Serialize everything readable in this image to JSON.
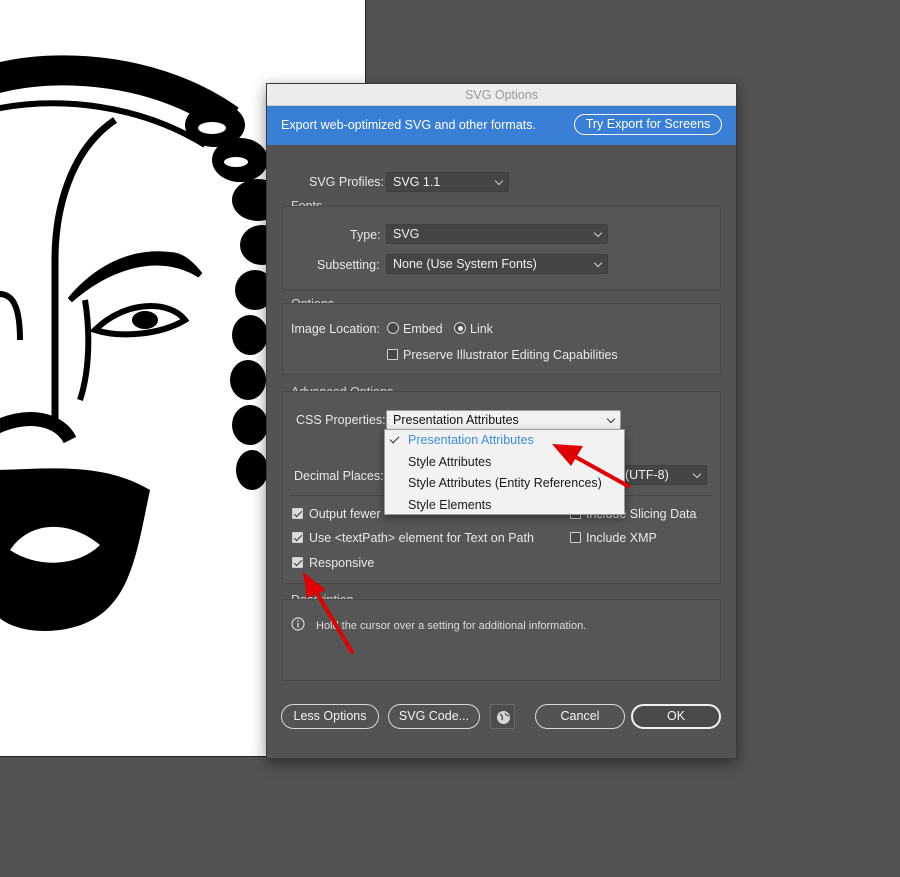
{
  "dialog": {
    "title": "SVG Options",
    "banner_text": "Export web-optimized SVG and other formats.",
    "banner_button": "Try Export for Screens",
    "svg_profiles": {
      "label": "SVG Profiles:",
      "value": "SVG 1.1"
    },
    "fonts": {
      "title": "Fonts",
      "type_label": "Type:",
      "type_value": "SVG",
      "subsetting_label": "Subsetting:",
      "subsetting_value": "None (Use System Fonts)"
    },
    "options": {
      "title": "Options",
      "image_location_label": "Image Location:",
      "embed_label": "Embed",
      "link_label": "Link",
      "selected_location": "Link",
      "preserve_label": "Preserve Illustrator Editing Capabilities",
      "preserve_checked": false
    },
    "advanced": {
      "title": "Advanced Options",
      "css_label": "CSS Properties:",
      "css_value": "Presentation Attributes",
      "css_options": [
        "Presentation Attributes",
        "Style Attributes",
        "Style Attributes (Entity References)",
        "Style Elements"
      ],
      "css_selected_index": 0,
      "decimal_label": "Decimal Places:",
      "encoding_visible_text": "(UTF-8)",
      "output_fewer_label": "Output fewer <tspan> elements",
      "output_fewer_visible": "Output fewer",
      "output_fewer_checked": true,
      "include_slicing_label": "Include Slicing Data",
      "include_slicing_checked": false,
      "textpath_label": "Use <textPath> element for Text on Path",
      "textpath_checked": true,
      "include_xmp_label": "Include XMP",
      "include_xmp_checked": false,
      "responsive_label": "Responsive",
      "responsive_checked": true
    },
    "description": {
      "title": "Description",
      "text": "Hold the cursor over a setting for additional information."
    },
    "buttons": {
      "less_options": "Less Options",
      "svg_code": "SVG Code...",
      "cancel": "Cancel",
      "ok": "OK"
    }
  },
  "colors": {
    "banner": "#3a7fd6",
    "dialog_bg": "#535353",
    "selected_option": "#3b8de0",
    "annotation_arrow": "#e00000"
  },
  "icons": [
    "info-icon",
    "globe-icon",
    "chevron-down-icon",
    "checkmark-icon"
  ]
}
